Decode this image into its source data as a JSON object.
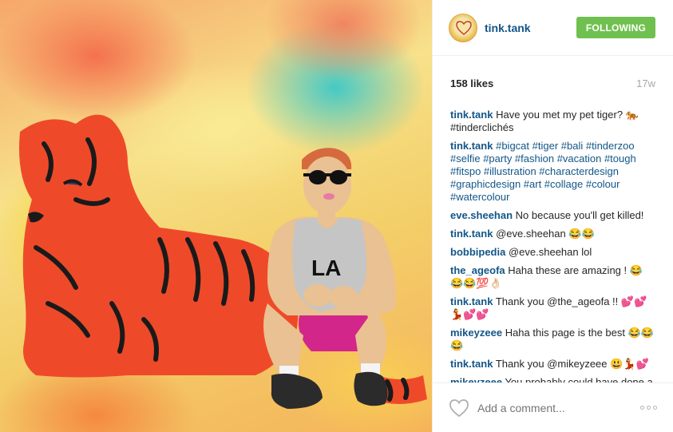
{
  "header": {
    "username": "tink.tank",
    "follow_label": "FOLLOWING",
    "avatar_icon": "tink-tank-logo"
  },
  "post": {
    "likes": "158 likes",
    "time": "17w"
  },
  "comments": [
    {
      "user": "tink.tank",
      "text": "Have you met my pet tiger? 🐅 #tinderclichés"
    },
    {
      "user": "tink.tank",
      "text": "#bigcat #tiger #bali #tinderzoo #selfie #party #fashion #vacation #tough #fitspo #illustration #characterdesign #graphicdesign #art #collage #colour #watercolour"
    },
    {
      "user": "eve.sheehan",
      "text": "No because you'll get killed!"
    },
    {
      "user": "tink.tank",
      "text": "@eve.sheehan 😂😂"
    },
    {
      "user": "bobbipedia",
      "text": "@eve.sheehan lol"
    },
    {
      "user": "the_ageofa",
      "text": "Haha these are amazing ! 😂😂😂💯👌🏻"
    },
    {
      "user": "tink.tank",
      "text": "Thank you @the_ageofa !! 💕💕💃💕💕"
    },
    {
      "user": "mikeyzeee",
      "text": "Haha this page is the best 😂😂😂"
    },
    {
      "user": "tink.tank",
      "text": "Thank you @mikeyzeee 😃💃💕"
    },
    {
      "user": "mikeyzeee",
      "text": "You probably could have done a separate page just for sedated tiger pics!"
    }
  ],
  "footer": {
    "comment_placeholder": "Add a comment...",
    "like_icon": "heart-icon",
    "more_icon": "more-options-icon"
  },
  "colors": {
    "link": "#125688",
    "follow_button": "#70c050",
    "muted": "#a5a7aa"
  }
}
